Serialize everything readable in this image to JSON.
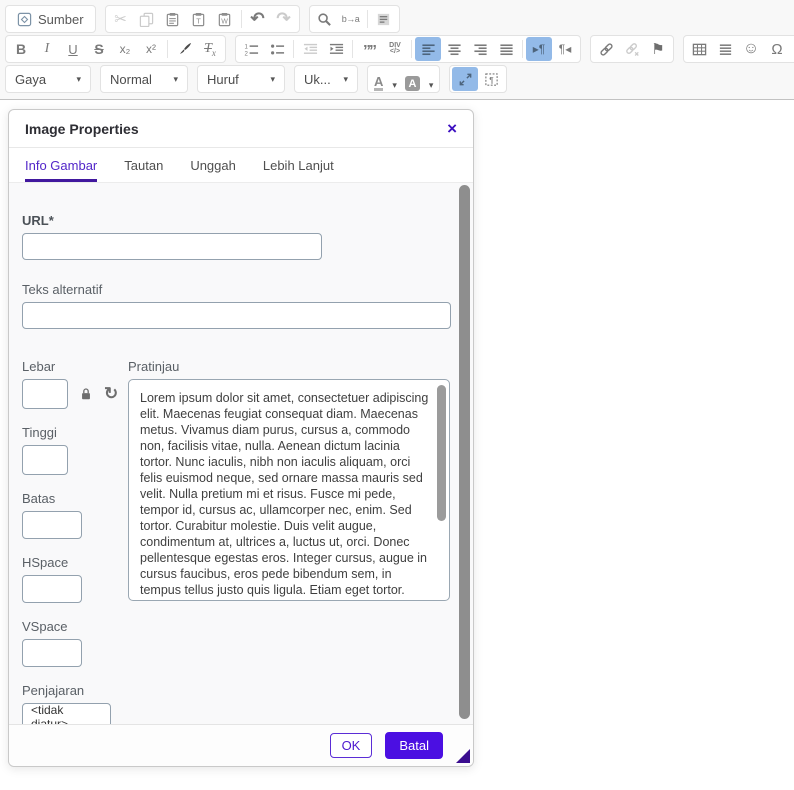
{
  "colors": {
    "accent_purple": "#4b0fe2",
    "tab_active_purple": "#5226c9",
    "active_button_blue": "#93bae8",
    "icon_gray": "#7a7a7a",
    "icon_disabled": "#cbcbcb"
  },
  "toolbar": {
    "source_button_label": "Sumber",
    "glyphs": {
      "cut": "✂",
      "undo": "↶",
      "redo": "↷",
      "replace": "b→a",
      "bold": "B",
      "italic": "I",
      "underline": "U",
      "strike": "S",
      "subscript": "x₂",
      "superscript": "x²",
      "removeformat_t": "T",
      "removeformat_x": "x",
      "blockquote": "””",
      "div_top": "DIV",
      "div_bottom": "</>",
      "ltr": "▸¶",
      "rtl": "¶◂",
      "anchor": "⚑",
      "smiley": "☺",
      "specialchar": "Ω",
      "textcolor": "A",
      "bgcolor": "A",
      "dropdown": "▾",
      "reset": "↻"
    },
    "combos": {
      "styles": "Gaya",
      "format": "Normal",
      "font": "Huruf",
      "size": "Uk..."
    }
  },
  "dialog": {
    "title": "Image Properties",
    "close_glyph": "×",
    "tabs": [
      {
        "label": "Info Gambar",
        "active": true
      },
      {
        "label": "Tautan",
        "active": false
      },
      {
        "label": "Unggah",
        "active": false
      },
      {
        "label": "Lebih Lanjut",
        "active": false
      }
    ],
    "fields": {
      "url_label": "URL*",
      "url_value": "",
      "alt_label": "Teks alternatif",
      "alt_value": "",
      "width_label": "Lebar",
      "width_value": "",
      "height_label": "Tinggi",
      "height_value": "",
      "border_label": "Batas",
      "border_value": "",
      "hspace_label": "HSpace",
      "hspace_value": "",
      "vspace_label": "VSpace",
      "vspace_value": "",
      "align_label": "Penjajaran",
      "align_value": "<tidak diatur>"
    },
    "preview": {
      "label": "Pratinjau",
      "text": "Lorem ipsum dolor sit amet, consectetuer adipiscing elit. Maecenas feugiat consequat diam. Maecenas metus. Vivamus diam purus, cursus a, commodo non, facilisis vitae, nulla. Aenean dictum lacinia tortor. Nunc iaculis, nibh non iaculis aliquam, orci felis euismod neque, sed ornare massa mauris sed velit. Nulla pretium mi et risus. Fusce mi pede, tempor id, cursus ac, ullamcorper nec, enim. Sed tortor. Curabitur molestie. Duis velit augue, condimentum at, ultrices a, luctus ut, orci. Donec pellentesque egestas eros. Integer cursus, augue in cursus faucibus, eros pede bibendum sem, in tempus tellus justo quis ligula. Etiam eget tortor. Vestibulum rutrum, est ut placerat elementum, lectus nisl aliquam velit, tempor aliquam"
    },
    "buttons": {
      "ok": "OK",
      "cancel": "Batal"
    }
  }
}
